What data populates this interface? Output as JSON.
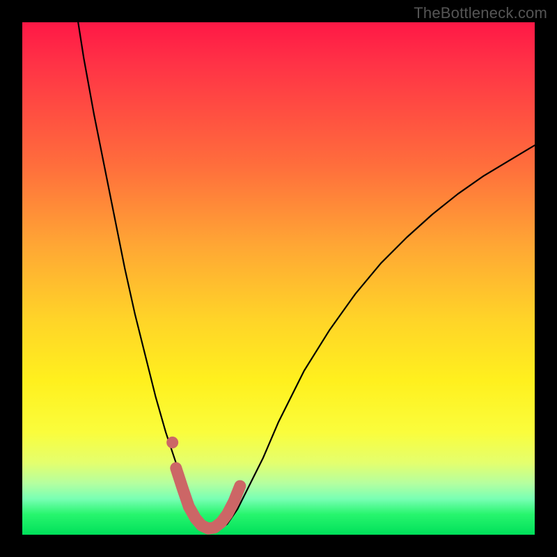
{
  "watermark": "TheBottleneck.com",
  "chart_data": {
    "type": "line",
    "title": "",
    "xlabel": "",
    "ylabel": "",
    "xlim": [
      0,
      100
    ],
    "ylim": [
      0,
      100
    ],
    "grid": false,
    "legend": false,
    "curve_x": [
      10.9,
      12,
      14,
      16,
      18,
      20,
      22,
      24,
      26,
      28,
      30,
      31,
      32,
      33,
      34,
      35,
      36,
      37,
      38,
      39,
      40,
      42,
      44,
      47,
      50,
      55,
      60,
      65,
      70,
      75,
      80,
      85,
      90,
      95,
      100
    ],
    "curve_y": [
      100,
      93,
      82,
      72,
      62,
      52,
      43,
      35,
      27,
      20,
      14,
      11,
      9,
      6.5,
      4.5,
      3,
      2,
      1.4,
      1.1,
      1.4,
      2.1,
      5,
      9,
      15,
      22,
      32,
      40,
      47,
      53,
      58,
      62.5,
      66.5,
      70,
      73,
      76
    ],
    "marker_segment_x": [
      30,
      31.3,
      32.5,
      33.8,
      35,
      36.3,
      37.5,
      38.8,
      40,
      41.3,
      42.5
    ],
    "marker_segment_y": [
      13,
      9,
      5.5,
      3.2,
      1.8,
      1.2,
      1.4,
      2.4,
      4,
      6.5,
      9.5
    ],
    "extra_marker": {
      "x": 29.3,
      "y": 18
    },
    "colors": {
      "curve": "#000000",
      "marker": "#cc6666"
    }
  }
}
